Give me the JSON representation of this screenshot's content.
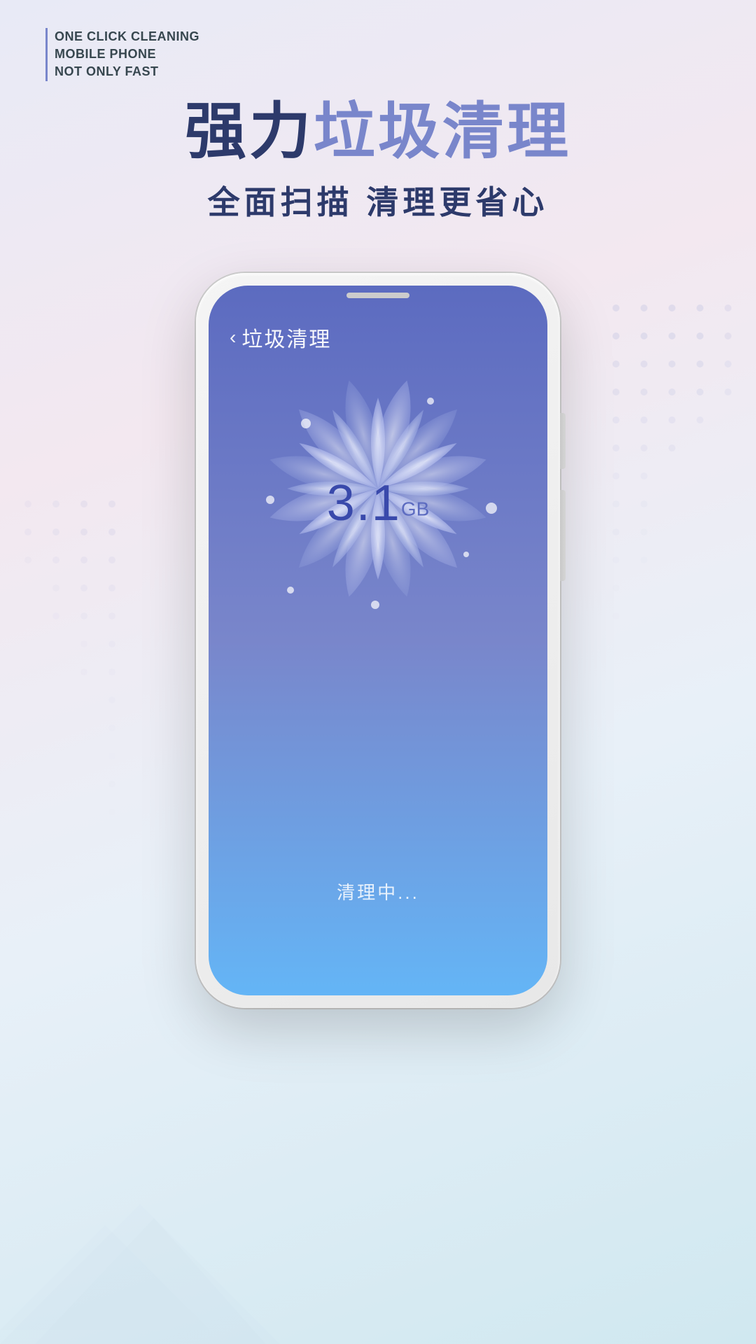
{
  "branding": {
    "line1": "ONE CLICK CLEANING",
    "line2": "MOBILE PHONE",
    "line3": "NOT ONLY FAST"
  },
  "headline": {
    "part1": "强力",
    "part2": "垃圾清理",
    "subtitle": "全面扫描  清理更省心"
  },
  "phone_screen": {
    "back_icon": "‹",
    "title": "垃圾清理",
    "size_value": "3.1",
    "size_unit": "GB",
    "status": "清理中..."
  },
  "colors": {
    "accent_purple": "#7986cb",
    "dark_blue": "#2d3a6b",
    "screen_top": "#5c6bc0",
    "screen_bottom": "#64b5f6"
  }
}
